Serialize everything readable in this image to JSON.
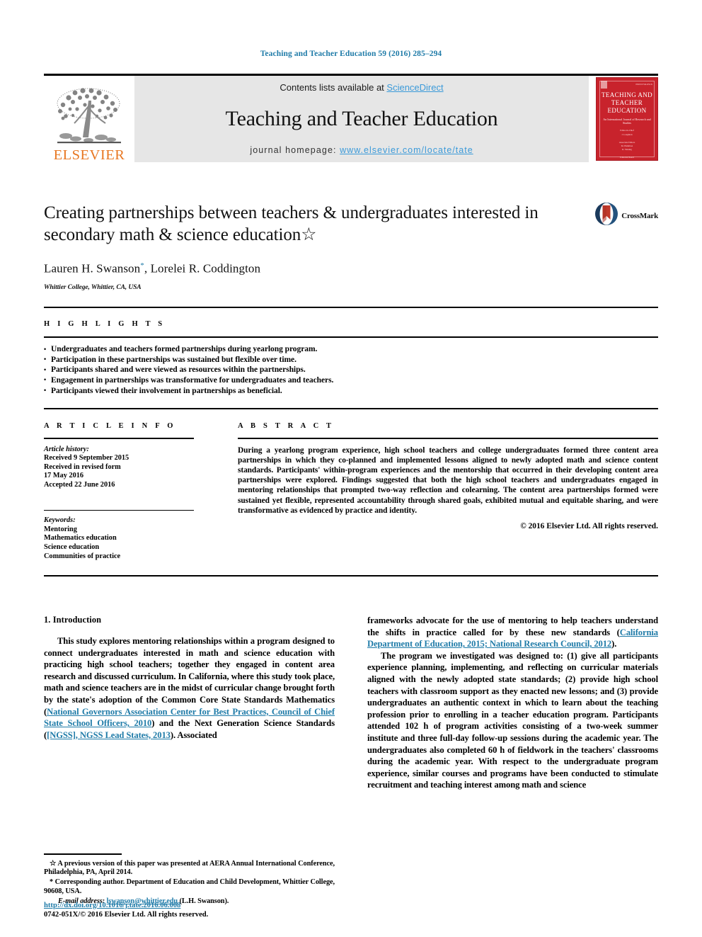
{
  "running_head": "Teaching and Teacher Education 59 (2016) 285–294",
  "masthead": {
    "contents_prefix": "Contents lists available at ",
    "sciencedirect": "ScienceDirect",
    "journal_name": "Teaching and Teacher Education",
    "homepage_label": "journal homepage: ",
    "homepage_url": "www.elsevier.com/locate/tate",
    "publisher": "ELSEVIER",
    "cover": {
      "title": "TEACHING AND TEACHER EDUCATION",
      "subtitle": "An International Journal of Research and Studies",
      "code": "ISSN 0742-051X",
      "names": "Editor-in-Chief\nJ. Loughran\n\nAssociate Editors\nM. Hamilton\nR. Tinning\n\nEditorial Board\nE. Ben-Peretz\nA. Berry"
    },
    "colors": {
      "link": "#3b9ad9",
      "band": "#e6e6e6",
      "elsevier_orange": "#e87722",
      "cover_red": "#c8232c"
    }
  },
  "title_block": {
    "title": "Creating partnerships between teachers & undergraduates interested in secondary math & science education☆",
    "authors_html": "Lauren H. Swanson*, Lorelei R. Coddington",
    "author_1": "Lauren H. Swanson",
    "author_1_marker": "*",
    "author_2": "Lorelei R. Coddington",
    "affiliation": "Whittier College, Whittier, CA, USA",
    "crossmark_label": "CrossMark"
  },
  "highlights": {
    "label": "H I G H L I G H T S",
    "items": [
      "Undergraduates and teachers formed partnerships during yearlong program.",
      "Participation in these partnerships was sustained but flexible over time.",
      "Participants shared and were viewed as resources within the partnerships.",
      "Engagement in partnerships was transformative for undergraduates and teachers.",
      "Participants viewed their involvement in partnerships as beneficial."
    ]
  },
  "article_info": {
    "label": "A R T I C L E   I N F O",
    "history_title": "Article history:",
    "history_lines": [
      "Received 9 September 2015",
      "Received in revised form",
      "17 May 2016",
      "Accepted 22 June 2016"
    ],
    "keywords_title": "Keywords:",
    "keywords": [
      "Mentoring",
      "Mathematics education",
      "Science education",
      "Communities of practice"
    ]
  },
  "abstract": {
    "label": "A B S T R A C T",
    "text": "During a yearlong program experience, high school teachers and college undergraduates formed three content area partnerships in which they co-planned and implemented lessons aligned to newly adopted math and science content standards. Participants' within-program experiences and the mentorship that occurred in their developing content area partnerships were explored. Findings suggested that both the high school teachers and undergraduates engaged in mentoring relationships that prompted two-way reflection and colearning. The content area partnerships formed were sustained yet flexible, represented accountability through shared goals, exhibited mutual and equitable sharing, and were transformative as evidenced by practice and identity.",
    "copyright": "© 2016 Elsevier Ltd. All rights reserved."
  },
  "body": {
    "section_heading": "1. Introduction",
    "left_para_1_a": "This study explores mentoring relationships within a program designed to connect undergraduates interested in math and science education with practicing high school teachers; together they engaged in content area research and discussed curriculum. In California, where this study took place, math and science teachers are in the midst of curricular change brought forth by the state's adoption of the Common Core State Standards Mathematics (",
    "left_cite_1": "National Governors Association Center for Best Practices, Council of Chief State School Officers, 2010",
    "left_para_1_b": ") and the Next Generation Science Standards (",
    "left_cite_2": "[NGSS], NGSS Lead States, 2013",
    "left_para_1_c": "). Associated",
    "right_para_1_a": "frameworks advocate for the use of mentoring to help teachers understand the shifts in practice called for by these new standards (",
    "right_cite_1": "California Department of Education, 2015; National Research Council, 2012",
    "right_para_1_b": ").",
    "right_para_2": "The program we investigated was designed to: (1) give all participants experience planning, implementing, and reflecting on curricular materials aligned with the newly adopted state standards; (2) provide high school teachers with classroom support as they enacted new lessons; and (3) provide undergraduates an authentic context in which to learn about the teaching profession prior to enrolling in a teacher education program. Participants attended 102 h of program activities consisting of a two-week summer institute and three full-day follow-up sessions during the academic year. The undergraduates also completed 60 h of fieldwork in the teachers' classrooms during the academic year. With respect to the undergraduate program experience, similar courses and programs have been conducted to stimulate recruitment and teaching interest among math and science"
  },
  "footnotes": {
    "star_note": "☆ A previous version of this paper was presented at AERA Annual International Conference, Philadelphia, PA, April 2014.",
    "corresponding": "* Corresponding author. Department of Education and Child Development, Whittier College, 90608, USA.",
    "email_label": "E-mail address:",
    "email": "lswanson@whittier.edu",
    "email_suffix": "(L.H. Swanson).",
    "doi": "http://dx.doi.org/10.1016/j.tate.2016.06.008",
    "issn_line": "0742-051X/© 2016 Elsevier Ltd. All rights reserved."
  }
}
